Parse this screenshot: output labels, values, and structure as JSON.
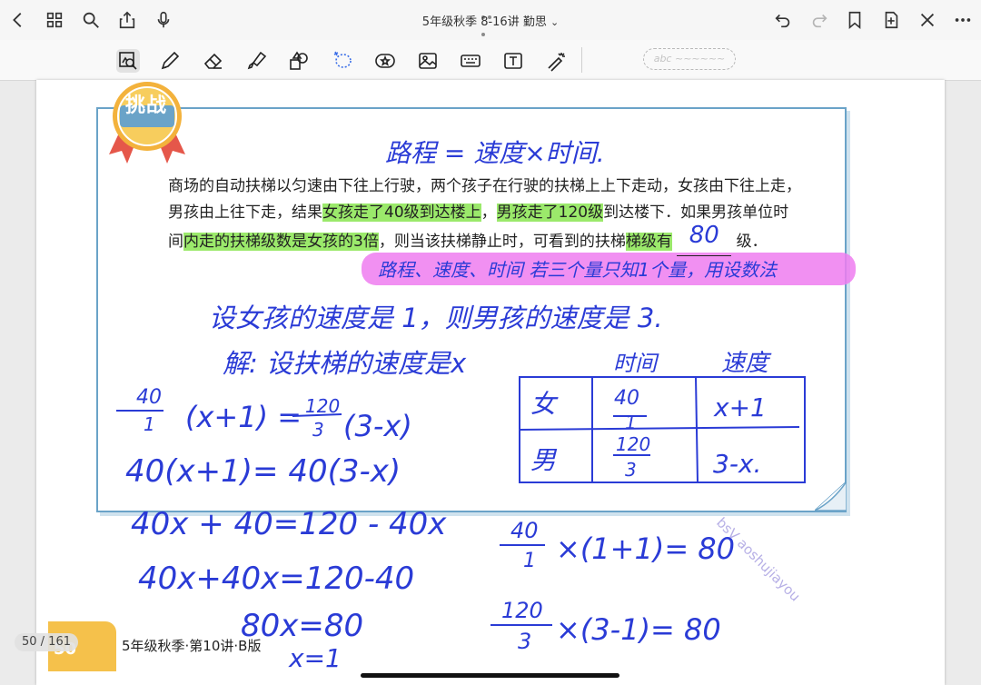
{
  "titlebar": {
    "doc_title": "5年级秋季 8-16讲 勤思",
    "title_chevron": "⌄",
    "icons_left": [
      "back-chevron-icon",
      "grid-icon",
      "search-icon",
      "share-icon",
      "microphone-icon"
    ],
    "icons_right": [
      "undo-icon",
      "redo-icon",
      "bookmark-icon",
      "add-page-icon",
      "close-icon",
      "more-icon"
    ]
  },
  "toolbar": {
    "tools": [
      "zoom-crop-tool",
      "pen-tool",
      "eraser-tool",
      "highlighter-tool",
      "shapes-tool",
      "lasso-tool",
      "sticker-tool",
      "image-tool",
      "keyboard-tool",
      "textbox-tool",
      "laser-pointer-tool"
    ],
    "active_tool": "zoom-crop-tool",
    "handwriting_placeholder": "abc ~~~~~~"
  },
  "page": {
    "badge_text": "挑战",
    "problem": {
      "seg1": "商场的自动扶梯以匀速由下往上行驶，两个孩子在行驶的扶梯上上下走动，女孩由下往上走，男孩由上往下走，结果",
      "hl1": "女孩走了40级到达楼上",
      "seg2": "，",
      "hl2": "男孩走了120级",
      "seg3": "到达楼下．如果男孩单位时间",
      "hl3": "内走的扶梯级数是女孩的3倍",
      "seg4": "，则当该扶梯静止时，可看到的扶梯",
      "hl4": "梯级有",
      "blank_answer": "80",
      "seg5": "级．"
    },
    "handwriting": {
      "formula": "路程 = 速度×时间.",
      "pink_note": "路程、速度、时间 若三个量只知1个量，用设数法",
      "line1": "设女孩的速度是 1，则男孩的速度是 3.",
      "line2": "解: 设扶梯的速度是x",
      "table_headers": [
        "时间",
        "速度"
      ],
      "table_rows": [
        {
          "label": "女",
          "time_num": "40",
          "time_den": "1",
          "speed": "x+1"
        },
        {
          "label": "男",
          "time_num": "120",
          "time_den": "3",
          "speed": "3-x."
        }
      ],
      "eq1_left_num": "40",
      "eq1_left_den": "1",
      "eq1_left_rest": "(x+1) =",
      "eq1_right_num": "120",
      "eq1_right_den": "3",
      "eq1_right_rest": "(3-x)",
      "eq2": "40(x+1)= 40(3-x)",
      "eq3": "40x + 40=120 - 40x",
      "eq4": "40x+40x=120-40",
      "eq5": "80x=80",
      "eq6": "x=1",
      "calc1_num": "40",
      "calc1_den": "1",
      "calc1_rest": "×(1+1)= 80",
      "calc2_num": "120",
      "calc2_den": "3",
      "calc2_rest": "×(3-1)= 80"
    },
    "watermark": "bsV aoshujiayou",
    "footer_number": "50",
    "footer_text": "5年级秋季·第10讲·B版",
    "page_indicator": "50 / 161"
  },
  "colors": {
    "ink": "#2a3bd6",
    "highlight_green": "#9be96b",
    "highlight_pink": "#ee7cf0",
    "frame_blue": "#6aa3c8",
    "badge_orange": "#f3b23c"
  }
}
